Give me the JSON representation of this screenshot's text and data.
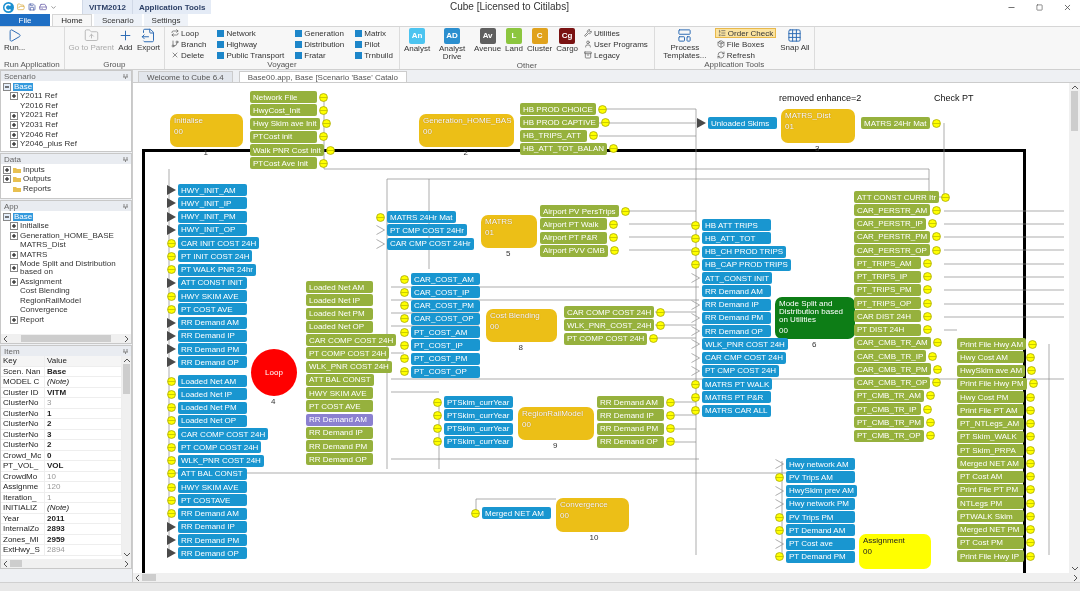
{
  "window": {
    "title": "Cube [Licensed to Citilabs]"
  },
  "context_tabs": [
    {
      "label": "VITM2012"
    },
    {
      "label": "Application Tools"
    }
  ],
  "tabs": [
    {
      "label": "File",
      "kind": "menu",
      "selected": false
    },
    {
      "label": "Home",
      "kind": "tab",
      "selected": true
    },
    {
      "label": "Scenario",
      "kind": "tab",
      "selected": false
    },
    {
      "label": "Settings",
      "kind": "tab",
      "selected": false
    }
  ],
  "ribbon": {
    "groups": [
      {
        "label": "Run Application",
        "buttons": [
          {
            "label": "Run...",
            "kind": "large",
            "disabled": false
          }
        ]
      },
      {
        "label": "Group",
        "buttons": [
          {
            "label": "Go to Parent",
            "kind": "large",
            "disabled": true
          },
          {
            "label": "Add",
            "kind": "large",
            "disabled": false
          },
          {
            "label": "Export",
            "kind": "large",
            "disabled": false
          }
        ]
      },
      {
        "label": "Voyager",
        "buttons": [
          {
            "label": "Loop",
            "kind": "small",
            "disabled": false
          },
          {
            "label": "Branch",
            "kind": "small",
            "disabled": false
          },
          {
            "label": "Delete",
            "kind": "small",
            "disabled": false
          },
          {
            "label": "Network",
            "kind": "module",
            "disabled": false
          },
          {
            "label": "Highway",
            "kind": "module",
            "disabled": false
          },
          {
            "label": "Public Transport",
            "kind": "module",
            "disabled": false
          },
          {
            "label": "Generation",
            "kind": "module",
            "disabled": false
          },
          {
            "label": "Distribution",
            "kind": "module",
            "disabled": false
          },
          {
            "label": "Fratar",
            "kind": "module",
            "disabled": false
          },
          {
            "label": "Matrix",
            "kind": "module",
            "disabled": false
          },
          {
            "label": "Pilot",
            "kind": "module",
            "disabled": false
          },
          {
            "label": "Trnbuild",
            "kind": "module",
            "disabled": false
          }
        ]
      },
      {
        "label": "Other",
        "buttons": [
          {
            "label": "Analyst",
            "kind": "tile",
            "badge": "An",
            "color": "#4cc4f0",
            "disabled": false
          },
          {
            "label": "Analyst Drive",
            "kind": "tile",
            "badge": "AD",
            "color": "#2b8fcf",
            "disabled": false
          },
          {
            "label": "Avenue",
            "kind": "tile",
            "badge": "Av",
            "color": "#5f5f5f",
            "disabled": false
          },
          {
            "label": "Land",
            "kind": "tile",
            "badge": "L",
            "color": "#8cc63f",
            "disabled": false
          },
          {
            "label": "Cluster",
            "kind": "tile",
            "badge": "C",
            "color": "#e0a21c",
            "disabled": false
          },
          {
            "label": "Cargo",
            "kind": "tile",
            "badge": "Cg",
            "color": "#7a1212",
            "disabled": false
          },
          {
            "label": "Utilities",
            "kind": "small",
            "disabled": false
          },
          {
            "label": "User Programs",
            "kind": "small",
            "disabled": false
          },
          {
            "label": "Legacy",
            "kind": "small",
            "disabled": false
          }
        ]
      },
      {
        "label": "Application Tools",
        "buttons": [
          {
            "label": "Process Templates...",
            "kind": "large",
            "disabled": false
          },
          {
            "label": "Order Check",
            "kind": "small",
            "disabled": false,
            "highlighted": true
          },
          {
            "label": "File Boxes",
            "kind": "small",
            "disabled": false,
            "highlighted": false
          },
          {
            "label": "Refresh",
            "kind": "small",
            "disabled": false,
            "highlighted": false
          },
          {
            "label": "Snap All",
            "kind": "large",
            "disabled": false
          }
        ]
      }
    ]
  },
  "panels": {
    "scenario": {
      "title": "Scenario",
      "items": [
        {
          "label": "Base",
          "expanded": true,
          "selected": true,
          "children": [
            {
              "label": "Y2011 Ref",
              "expanded": false,
              "selected": false
            },
            {
              "label": "Y2016 Ref",
              "selected": false
            },
            {
              "label": "Y2021 Ref",
              "expanded": false,
              "selected": false
            },
            {
              "label": "Y2031 Ref",
              "expanded": false,
              "selected": false
            },
            {
              "label": "Y2046 Ref",
              "expanded": false,
              "selected": false
            },
            {
              "label": "Y2046_plus Ref",
              "expanded": false,
              "selected": false
            }
          ]
        }
      ]
    },
    "data": {
      "title": "Data",
      "items": [
        {
          "label": "Inputs",
          "expanded": false,
          "selected": false
        },
        {
          "label": "Outputs",
          "expanded": false,
          "selected": false
        },
        {
          "label": "Reports",
          "selected": false
        }
      ]
    },
    "app": {
      "title": "App",
      "items": [
        {
          "label": "Base",
          "expanded": true,
          "selected": true,
          "children": [
            {
              "label": "Initialise",
              "expanded": false,
              "selected": false
            },
            {
              "label": "Generation_HOME_BASE",
              "expanded": false,
              "selected": false
            },
            {
              "label": "MATRS_Dist",
              "selected": false
            },
            {
              "label": "MATRS",
              "expanded": false,
              "selected": false
            },
            {
              "label": "Mode Split and Distribution based on",
              "expanded": false,
              "selected": false
            },
            {
              "label": "Assignment",
              "expanded": false,
              "selected": false
            },
            {
              "label": "Cost Blending",
              "selected": false
            },
            {
              "label": "RegionRailModel",
              "selected": false
            },
            {
              "label": "Convergence",
              "selected": false
            },
            {
              "label": "Report",
              "expanded": false,
              "selected": false
            }
          ]
        }
      ]
    },
    "item": {
      "title": "Item",
      "columns": [
        "Key",
        "Value"
      ],
      "rows": [
        {
          "key": "Scen. Nan",
          "value": "Base",
          "kind": "set"
        },
        {
          "key": "MODEL C",
          "value": "(Note)",
          "kind": "note"
        },
        {
          "key": "Cluster ID",
          "value": "VITM",
          "kind": "set"
        },
        {
          "key": "ClusterNo",
          "value": "3",
          "kind": "default"
        },
        {
          "key": "ClusterNo",
          "value": "1",
          "kind": "set"
        },
        {
          "key": "ClusterNo",
          "value": "2",
          "kind": "set"
        },
        {
          "key": "ClusterNo",
          "value": "3",
          "kind": "set"
        },
        {
          "key": "ClusterNo",
          "value": "2",
          "kind": "set"
        },
        {
          "key": "Crowd_Mc",
          "value": "0",
          "kind": "set"
        },
        {
          "key": "PT_VOL_",
          "value": "VOL",
          "kind": "set"
        },
        {
          "key": "CrowdMo",
          "value": "10",
          "kind": "default"
        },
        {
          "key": "Assignme",
          "value": "120",
          "kind": "default"
        },
        {
          "key": "Iteration_",
          "value": "1",
          "kind": "default"
        },
        {
          "key": "INITIALIZ",
          "value": "(Note)",
          "kind": "note"
        },
        {
          "key": "Year",
          "value": "2011",
          "kind": "set"
        },
        {
          "key": "InternalZo",
          "value": "2893",
          "kind": "set"
        },
        {
          "key": "Zones_MI",
          "value": "2959",
          "kind": "set"
        },
        {
          "key": "ExtHwy_S",
          "value": "2894",
          "kind": "default"
        }
      ]
    }
  },
  "documents": [
    {
      "label": "Welcome to Cube 6.4",
      "selected": false
    },
    {
      "label": "Base00.app, Base [Scenario 'Base' Catalo",
      "selected": true
    }
  ],
  "canvas": {
    "notes": [
      {
        "text": "removed enhance=2"
      },
      {
        "text": "Check PT"
      }
    ],
    "programs": [
      {
        "name": "Initialise",
        "code": "00",
        "step": "1",
        "kind": "program"
      },
      {
        "name": "Generation_HOME_BAS",
        "code": "00",
        "step": "2",
        "kind": "program"
      },
      {
        "name": "MATRS_Dist",
        "code": "01",
        "step": "3",
        "kind": "program"
      },
      {
        "name": "Loop",
        "step": "4",
        "kind": "loop"
      },
      {
        "name": "MATRS",
        "code": "01",
        "step": "5",
        "kind": "program"
      },
      {
        "name": "Cost Blending",
        "code": "00",
        "step": "8",
        "kind": "program"
      },
      {
        "name": "Mode Split and Distribution based on Utilities",
        "code": "00",
        "step": "6",
        "kind": "user"
      },
      {
        "name": "RegionRailModel",
        "code": "00",
        "step": "9",
        "kind": "program"
      },
      {
        "name": "Convergence",
        "code": "00",
        "step": "10",
        "kind": "program"
      },
      {
        "name": "Assignment",
        "code": "00",
        "kind": "highlight"
      }
    ],
    "file_groups": [
      {
        "kind": "output",
        "items": [
          {
            "label": "Network File",
            "kind": "circle",
            "selected": false
          },
          {
            "label": "HwyCost_Init",
            "kind": "circle",
            "selected": false
          },
          {
            "label": "Hwy Skim ave Init",
            "kind": "circle",
            "selected": false
          },
          {
            "label": "PTCost init",
            "kind": "circle",
            "selected": false
          },
          {
            "label": "Walk PNR Cost init",
            "kind": "circle",
            "selected": false
          },
          {
            "label": "PTCost Ave Init",
            "kind": "circle",
            "selected": false
          }
        ]
      },
      {
        "kind": "output",
        "items": [
          {
            "label": "HB PROD CHOICE",
            "kind": "circle",
            "selected": false
          },
          {
            "label": "HB PROD CAPTIVE",
            "kind": "circle",
            "selected": false
          },
          {
            "label": "HB_TRIPS_ATT",
            "kind": "circle",
            "selected": false
          },
          {
            "label": "HB_ATT_TOT_BALAN",
            "kind": "circle",
            "selected": false
          }
        ]
      },
      {
        "kind": "input",
        "items": [
          {
            "label": "Unloaded Skims",
            "kind": "triangle",
            "selected": false
          }
        ]
      },
      {
        "kind": "output",
        "items": [
          {
            "label": "MATRS 24Hr Mat",
            "kind": "circle",
            "selected": false
          }
        ]
      },
      {
        "kind": "input",
        "items": [
          {
            "label": "HWY_INIT_AM",
            "kind": "triangle",
            "selected": false
          },
          {
            "label": "HWY_INIT_IP",
            "kind": "triangle",
            "selected": false
          },
          {
            "label": "HWY_INIT_PM",
            "kind": "triangle",
            "selected": false
          },
          {
            "label": "HWY_INIT_OP",
            "kind": "triangle",
            "selected": false
          },
          {
            "label": "CAR INIT COST 24H",
            "kind": "circle",
            "selected": false
          },
          {
            "label": "PT INIT COST 24H",
            "kind": "circle",
            "selected": false
          },
          {
            "label": "PT WALK PNR 24hr",
            "kind": "circle",
            "selected": false
          },
          {
            "label": "ATT CONST INIT",
            "kind": "triangle",
            "selected": false
          },
          {
            "label": "HWY SKIM AVE",
            "kind": "circle",
            "selected": false
          },
          {
            "label": "PT COST AVE",
            "kind": "circle",
            "selected": false
          },
          {
            "label": "RR Demand AM",
            "kind": "triangle",
            "selected": false
          },
          {
            "label": "RR Demand IP",
            "kind": "triangle",
            "selected": false
          },
          {
            "label": "RR Demand PM",
            "kind": "triangle",
            "selected": false
          },
          {
            "label": "RR Demand OP",
            "kind": "triangle",
            "selected": false
          }
        ]
      },
      {
        "kind": "input",
        "items": [
          {
            "label": "Loaded Net AM",
            "kind": "circle",
            "selected": false
          },
          {
            "label": "Loaded Net IP",
            "kind": "circle",
            "selected": false
          },
          {
            "label": "Loaded Net PM",
            "kind": "circle",
            "selected": false
          },
          {
            "label": "Loaded Net OP",
            "kind": "circle",
            "selected": false
          },
          {
            "label": "CAR COMP COST 24H",
            "kind": "circle",
            "selected": false
          },
          {
            "label": "PT COMP COST 24H",
            "kind": "circle",
            "selected": false
          },
          {
            "label": "WLK_PNR COST 24H",
            "kind": "circle",
            "selected": false
          },
          {
            "label": "ATT BAL CONST",
            "kind": "circle",
            "selected": false
          },
          {
            "label": "HWY SKIM AVE",
            "kind": "circle",
            "selected": false
          },
          {
            "label": "PT COSTAVE",
            "kind": "circle",
            "selected": false
          },
          {
            "label": "RR Demand AM",
            "kind": "circle",
            "selected": false
          },
          {
            "label": "RR Demand IP",
            "kind": "triangle",
            "selected": false
          },
          {
            "label": "RR Demand PM",
            "kind": "triangle",
            "selected": false
          },
          {
            "label": "RR Demand OP",
            "kind": "triangle",
            "selected": false
          }
        ]
      },
      {
        "kind": "input",
        "items": [
          {
            "label": "MATRS 24Hr Mat",
            "kind": "circle",
            "selected": false
          },
          {
            "label": "PT CMP COST 24Hr",
            "kind": "open",
            "selected": false
          },
          {
            "label": "CAR CMP COST 24Hr",
            "kind": "open",
            "selected": false
          }
        ]
      },
      {
        "kind": "output",
        "items": [
          {
            "label": "Airport PV PersTrips",
            "kind": "circle",
            "selected": false
          },
          {
            "label": "Airport PT Walk",
            "kind": "circle",
            "selected": false
          },
          {
            "label": "Airport PT P&R",
            "kind": "circle",
            "selected": false
          },
          {
            "label": "Airport PVV CMB",
            "kind": "circle",
            "selected": false
          }
        ]
      },
      {
        "kind": "output",
        "items": [
          {
            "label": "Loaded Net AM",
            "kind": "none",
            "selected": false
          },
          {
            "label": "Loaded Net IP",
            "kind": "none",
            "selected": false
          },
          {
            "label": "Loaded Net PM",
            "kind": "none",
            "selected": false
          },
          {
            "label": "Loaded Net OP",
            "kind": "none",
            "selected": false
          },
          {
            "label": "CAR COMP COST 24H",
            "kind": "none",
            "selected": false
          },
          {
            "label": "PT COMP COST 24H",
            "kind": "none",
            "selected": false
          },
          {
            "label": "WLK_PNR COST 24H",
            "kind": "none",
            "selected": false
          },
          {
            "label": "ATT BAL CONST",
            "kind": "none",
            "selected": false
          },
          {
            "label": "HWY SKIM AVE",
            "kind": "none",
            "selected": false
          },
          {
            "label": "PT COST AVE",
            "kind": "none",
            "selected": false
          },
          {
            "label": "RR Demand AM",
            "kind": "none",
            "selected": true
          },
          {
            "label": "RR Demand IP",
            "kind": "none",
            "selected": false
          },
          {
            "label": "RR Demand PM",
            "kind": "none",
            "selected": false
          },
          {
            "label": "RR Demand OP",
            "kind": "none",
            "selected": false
          }
        ]
      },
      {
        "kind": "input",
        "items": [
          {
            "label": "CAR_COST_AM",
            "kind": "circle",
            "selected": false
          },
          {
            "label": "CAR_COST_IP",
            "kind": "circle",
            "selected": false
          },
          {
            "label": "CAR_COST_PM",
            "kind": "circle",
            "selected": false
          },
          {
            "label": "CAR_COST_OP",
            "kind": "circle",
            "selected": false
          },
          {
            "label": "PT_COST_AM",
            "kind": "circle",
            "selected": false
          },
          {
            "label": "PT_COST_IP",
            "kind": "circle",
            "selected": false
          },
          {
            "label": "PT_COST_PM",
            "kind": "circle",
            "selected": false
          },
          {
            "label": "PT_COST_OP",
            "kind": "circle",
            "selected": false
          }
        ]
      },
      {
        "kind": "output",
        "items": [
          {
            "label": "CAR COMP COST 24H",
            "kind": "circle",
            "selected": false
          },
          {
            "label": "WLK_PNR_COST_24H",
            "kind": "circle",
            "selected": false
          },
          {
            "label": "PT COMP COST 24H",
            "kind": "circle",
            "selected": false
          }
        ]
      },
      {
        "kind": "input",
        "items": [
          {
            "label": "HB ATT TRIPS",
            "kind": "circle",
            "selected": false
          },
          {
            "label": "HB_ATT_TOT",
            "kind": "circle",
            "selected": false
          },
          {
            "label": "HB_CH PROD TRIPS",
            "kind": "circle",
            "selected": false
          },
          {
            "label": "HB_CAP PROD TRIPS",
            "kind": "circle",
            "selected": false
          },
          {
            "label": "ATT_CONST INIT",
            "kind": "open",
            "selected": false
          },
          {
            "label": "RR Demand AM",
            "kind": "none",
            "selected": false
          },
          {
            "label": "RR Demand IP",
            "kind": "open",
            "selected": false
          },
          {
            "label": "RR Demand PM",
            "kind": "open",
            "selected": false
          },
          {
            "label": "RR Demand OP",
            "kind": "open",
            "selected": false
          },
          {
            "label": "WLK_PNR COST 24H",
            "kind": "open",
            "selected": false
          },
          {
            "label": "CAR CMP COST 24H",
            "kind": "open",
            "selected": false
          },
          {
            "label": "PT CMP COST 24H",
            "kind": "open",
            "selected": false
          },
          {
            "label": "MATRS PT WALK",
            "kind": "circle",
            "selected": false
          },
          {
            "label": "MATRS PT P&R",
            "kind": "circle",
            "selected": false
          },
          {
            "label": "MATRS CAR ALL",
            "kind": "circle",
            "selected": false
          }
        ]
      },
      {
        "kind": "output",
        "items": [
          {
            "label": "ATT CONST CURR Itr",
            "kind": "circle",
            "selected": false
          },
          {
            "label": "CAR_PERSTR_AM",
            "kind": "circle",
            "selected": false
          },
          {
            "label": "CAR_PERSTR_IP",
            "kind": "circle",
            "selected": false
          },
          {
            "label": "CAR_PERSTR_PM",
            "kind": "circle",
            "selected": false
          },
          {
            "label": "CAR_PERSTR_OP",
            "kind": "circle",
            "selected": false
          },
          {
            "label": "PT_TRIPS_AM",
            "kind": "circle",
            "selected": false
          },
          {
            "label": "PT_TRIPS_IP",
            "kind": "circle",
            "selected": false
          },
          {
            "label": "PT_TRIPS_PM",
            "kind": "circle",
            "selected": false
          },
          {
            "label": "PT_TRIPS_OP",
            "kind": "circle",
            "selected": false
          },
          {
            "label": "CAR DIST 24H",
            "kind": "circle",
            "selected": false
          },
          {
            "label": "PT DIST 24H",
            "kind": "circle",
            "selected": false
          },
          {
            "label": "CAR_CMB_TR_AM",
            "kind": "circle",
            "selected": false
          },
          {
            "label": "CAR_CMB_TR_IP",
            "kind": "circle",
            "selected": false
          },
          {
            "label": "CAR_CMB_TR_PM",
            "kind": "circle",
            "selected": false
          },
          {
            "label": "CAR_CMB_TR_OP",
            "kind": "circle",
            "selected": false
          },
          {
            "label": "PT_CMB_TR_AM",
            "kind": "circle",
            "selected": false
          },
          {
            "label": "PT_CMB_TR_IP",
            "kind": "circle",
            "selected": false
          },
          {
            "label": "PT_CMB_TR_PM",
            "kind": "circle",
            "selected": false
          },
          {
            "label": "PT_CMB_TR_OP",
            "kind": "circle",
            "selected": false
          }
        ]
      },
      {
        "kind": "input",
        "items": [
          {
            "label": "PTSkim_currYear",
            "kind": "circle",
            "selected": false
          },
          {
            "label": "PTSkim_currYear",
            "kind": "circle",
            "selected": false
          },
          {
            "label": "PTSkim_currYear",
            "kind": "circle",
            "selected": false
          },
          {
            "label": "PTSkim_currYear",
            "kind": "circle",
            "selected": false
          }
        ]
      },
      {
        "kind": "output",
        "items": [
          {
            "label": "RR Demand AM",
            "kind": "circle",
            "selected": false
          },
          {
            "label": "RR Demand IP",
            "kind": "circle",
            "selected": false
          },
          {
            "label": "RR Demand PM",
            "kind": "circle",
            "selected": false
          },
          {
            "label": "RR Demand OP",
            "kind": "circle",
            "selected": false
          }
        ]
      },
      {
        "kind": "input",
        "items": [
          {
            "label": "Merged NET AM",
            "kind": "circle",
            "selected": false
          }
        ]
      },
      {
        "kind": "input",
        "items": [
          {
            "label": "Hwy network AM",
            "kind": "open",
            "selected": false
          },
          {
            "label": "PV Trips AM",
            "kind": "circle",
            "selected": false
          },
          {
            "label": "HwySkim prev AM",
            "kind": "open",
            "selected": false
          },
          {
            "label": "Hwy network PM",
            "kind": "open",
            "selected": false
          },
          {
            "label": "PV Trips PM",
            "kind": "circle",
            "selected": false
          },
          {
            "label": "PT Demand AM",
            "kind": "circle",
            "selected": false
          },
          {
            "label": "PT Cost ave",
            "kind": "open",
            "selected": false
          },
          {
            "label": "PT Demand PM",
            "kind": "circle",
            "selected": false
          }
        ]
      },
      {
        "kind": "output",
        "items": [
          {
            "label": "Print File Hwy AM",
            "kind": "circle",
            "selected": false
          },
          {
            "label": "Hwy Cost AM",
            "kind": "circle",
            "selected": false
          },
          {
            "label": "HwySkim ave AM",
            "kind": "circle",
            "selected": false
          },
          {
            "label": "Print File Hwy PM",
            "kind": "circle",
            "selected": false
          },
          {
            "label": "Hwy Cost PM",
            "kind": "circle",
            "selected": false
          },
          {
            "label": "Print File PT AM",
            "kind": "circle",
            "selected": false
          },
          {
            "label": "PT_NTLegs_AM",
            "kind": "circle",
            "selected": false
          },
          {
            "label": "PT Skim_WALK",
            "kind": "circle",
            "selected": false
          },
          {
            "label": "PT Skim_PRPA",
            "kind": "circle",
            "selected": false
          },
          {
            "label": "Merged NET AM",
            "kind": "circle",
            "selected": false
          },
          {
            "label": "PT Cost AM",
            "kind": "circle",
            "selected": false
          },
          {
            "label": "Print File PT PM",
            "kind": "circle",
            "selected": false
          },
          {
            "label": "NTLegs PM",
            "kind": "circle",
            "selected": false
          },
          {
            "label": "PTWALK Skim",
            "kind": "circle",
            "selected": false
          },
          {
            "label": "Merged NET PM",
            "kind": "circle",
            "selected": false
          },
          {
            "label": "PT Cost PM",
            "kind": "circle",
            "selected": false
          },
          {
            "label": "Print File Hwy IP",
            "kind": "circle",
            "selected": false
          }
        ]
      }
    ]
  }
}
